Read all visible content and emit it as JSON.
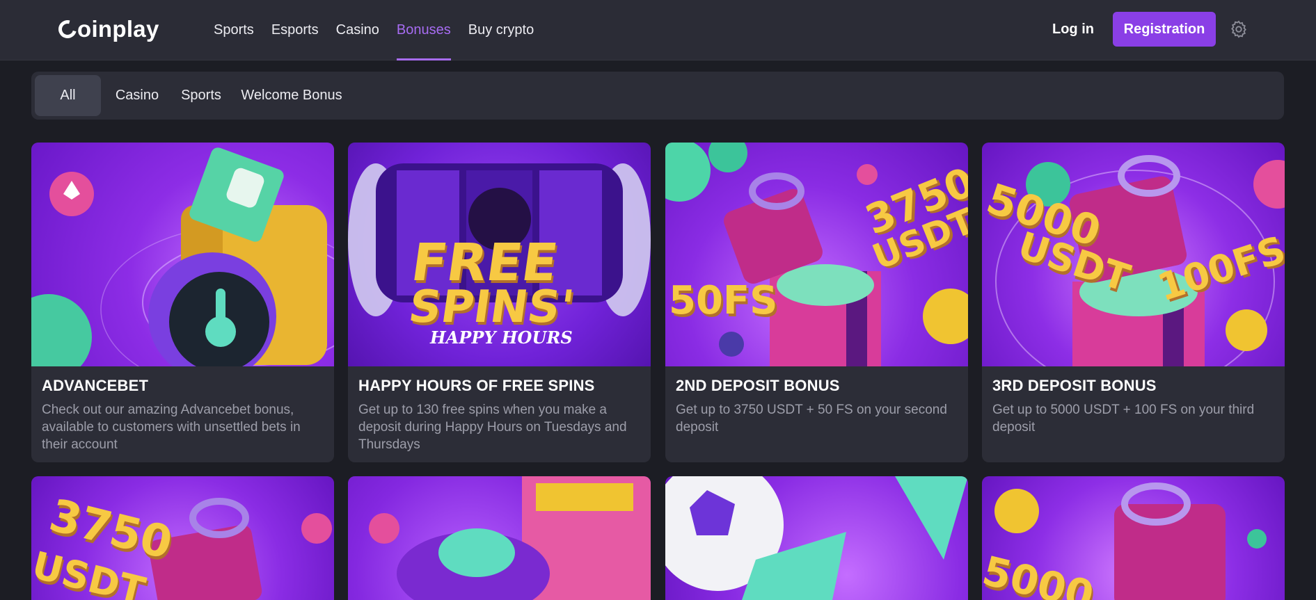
{
  "header": {
    "logo": "oinplay",
    "nav": [
      {
        "label": "Sports"
      },
      {
        "label": "Esports"
      },
      {
        "label": "Casino"
      },
      {
        "label": "Bonuses"
      },
      {
        "label": "Buy crypto"
      }
    ],
    "login_label": "Log in",
    "register_label": "Registration"
  },
  "filters": [
    {
      "label": "All"
    },
    {
      "label": "Casino"
    },
    {
      "label": "Sports"
    },
    {
      "label": "Welcome Bonus"
    }
  ],
  "cards": [
    {
      "title": "ADVANCEBET",
      "description": "Check out our amazing Advancebet bonus, available to customers with unsettled bets in their account"
    },
    {
      "title": "HAPPY HOURS OF FREE SPINS",
      "description": "Get up to 130 free spins when you make a deposit during Happy Hours on Tuesdays and Thursdays",
      "art_text": [
        "FREE",
        "SPINS'",
        "HAPPY HOURS"
      ]
    },
    {
      "title": "2ND DEPOSIT BONUS",
      "description": "Get up to 3750 USDT + 50 FS on your second deposit",
      "art_text": [
        "3750",
        "USDT",
        "50FS"
      ]
    },
    {
      "title": "3RD DEPOSIT BONUS",
      "description": "Get up to 5000 USDT + 100 FS on your third deposit",
      "art_text": [
        "5000",
        "USDT",
        "100FS"
      ]
    }
  ],
  "lower_art": [
    "3750",
    "USDT",
    "5000"
  ],
  "colors": {
    "accent": "#8a3fe6",
    "active_nav": "#a76cf2",
    "background": "#1c1d24",
    "panel": "#2c2d37"
  }
}
